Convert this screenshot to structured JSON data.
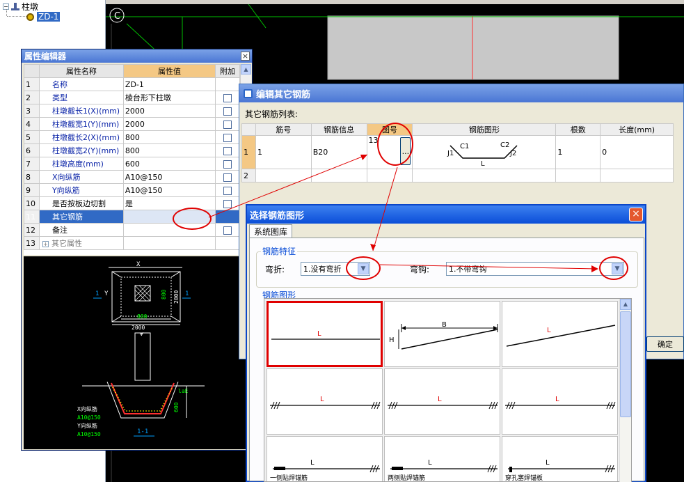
{
  "tree": {
    "root_label": "柱墩",
    "child_label": "ZD-1",
    "root_toggle": "⊟"
  },
  "cad": {
    "axis_label": "C"
  },
  "property_editor": {
    "title": "属性编辑器",
    "headers": [
      "属性名称",
      "属性值",
      "附加"
    ],
    "rows": [
      {
        "num": "1",
        "name": "名称",
        "value": "ZD-1",
        "has_check": false
      },
      {
        "num": "2",
        "name": "类型",
        "value": "棱台形下柱墩",
        "has_check": true
      },
      {
        "num": "3",
        "name": "柱墩截长1(X)(mm)",
        "value": "2000",
        "has_check": true
      },
      {
        "num": "4",
        "name": "柱墩截宽1(Y)(mm)",
        "value": "2000",
        "has_check": true
      },
      {
        "num": "5",
        "name": "柱墩截长2(X)(mm)",
        "value": "800",
        "has_check": true
      },
      {
        "num": "6",
        "name": "柱墩截宽2(Y)(mm)",
        "value": "800",
        "has_check": true
      },
      {
        "num": "7",
        "name": "柱墩高度(mm)",
        "value": "600",
        "has_check": true
      },
      {
        "num": "8",
        "name": "X向纵筋",
        "value": "A10@150",
        "has_check": true
      },
      {
        "num": "9",
        "name": "Y向纵筋",
        "value": "A10@150",
        "has_check": true
      },
      {
        "num": "10",
        "name": "是否按板边切割",
        "value": "是",
        "has_check": true
      },
      {
        "num": "11",
        "name": "其它钢筋",
        "value": "",
        "has_check": false
      },
      {
        "num": "12",
        "name": "备注",
        "value": "",
        "has_check": true
      },
      {
        "num": "13",
        "name": "其它属性",
        "value": "",
        "has_check": false
      }
    ],
    "expand_glyph": "+",
    "drawing": {
      "dim_top": "X",
      "dim_left_1": "1",
      "dim_left_y": "Y",
      "dim_right_1": "1",
      "dim_inner": "800",
      "dim_inner_v": "800",
      "dim_outer": "2000",
      "dim_outer_v": "2000",
      "dim_lae": "laE",
      "dim_height": "600",
      "x_bar_label": "X向纵筋",
      "x_bar_value": "A10@150",
      "y_bar_label": "Y向纵筋",
      "y_bar_value": "A10@150",
      "section_label": "1-1"
    }
  },
  "rebar_editor": {
    "title": "编辑其它钢筋",
    "list_label": "其它钢筋列表:",
    "headers": [
      "筋号",
      "钢筋信息",
      "图号",
      "钢筋图形",
      "根数",
      "长度(mm)"
    ],
    "rows": [
      {
        "num": "1",
        "bar_no": "1",
        "info": "B20",
        "figure_no": "13",
        "count": "1",
        "length": "0"
      },
      {
        "num": "2",
        "bar_no": "",
        "info": "",
        "figure_no": "",
        "count": "",
        "length": ""
      }
    ],
    "ellipsis": "...",
    "shape_labels": {
      "c1": "C1",
      "c2": "C2",
      "j1": "J1",
      "j2": "J2",
      "l": "L"
    },
    "ok_button": "确定"
  },
  "shape_selector": {
    "title": "选择钢筋图形",
    "tab": "系统图库",
    "feature_group": "钢筋特征",
    "bend_label": "弯折:",
    "bend_value": "1.没有弯折",
    "hook_label": "弯钩:",
    "hook_value": "1.不带弯钩",
    "shapes_group": "钢筋图形",
    "shapes": [
      {
        "label": "L"
      },
      {
        "label_b": "B",
        "label_h": "H"
      },
      {
        "label": "L"
      },
      {
        "label": "L"
      },
      {
        "label": "L"
      },
      {
        "label": "L"
      },
      {
        "label": "L",
        "caption": "一侧贴焊锚筋"
      },
      {
        "label": "L",
        "caption": "两侧贴焊锚筋"
      },
      {
        "label": "L",
        "caption": "穿孔塞焊锚板"
      }
    ]
  },
  "colors": {
    "accent_red": "#e00000",
    "title_blue": "#4a76d4",
    "header_orange": "#f4c884",
    "cad_green": "#00ff00",
    "cad_yellow": "#ffff00"
  }
}
